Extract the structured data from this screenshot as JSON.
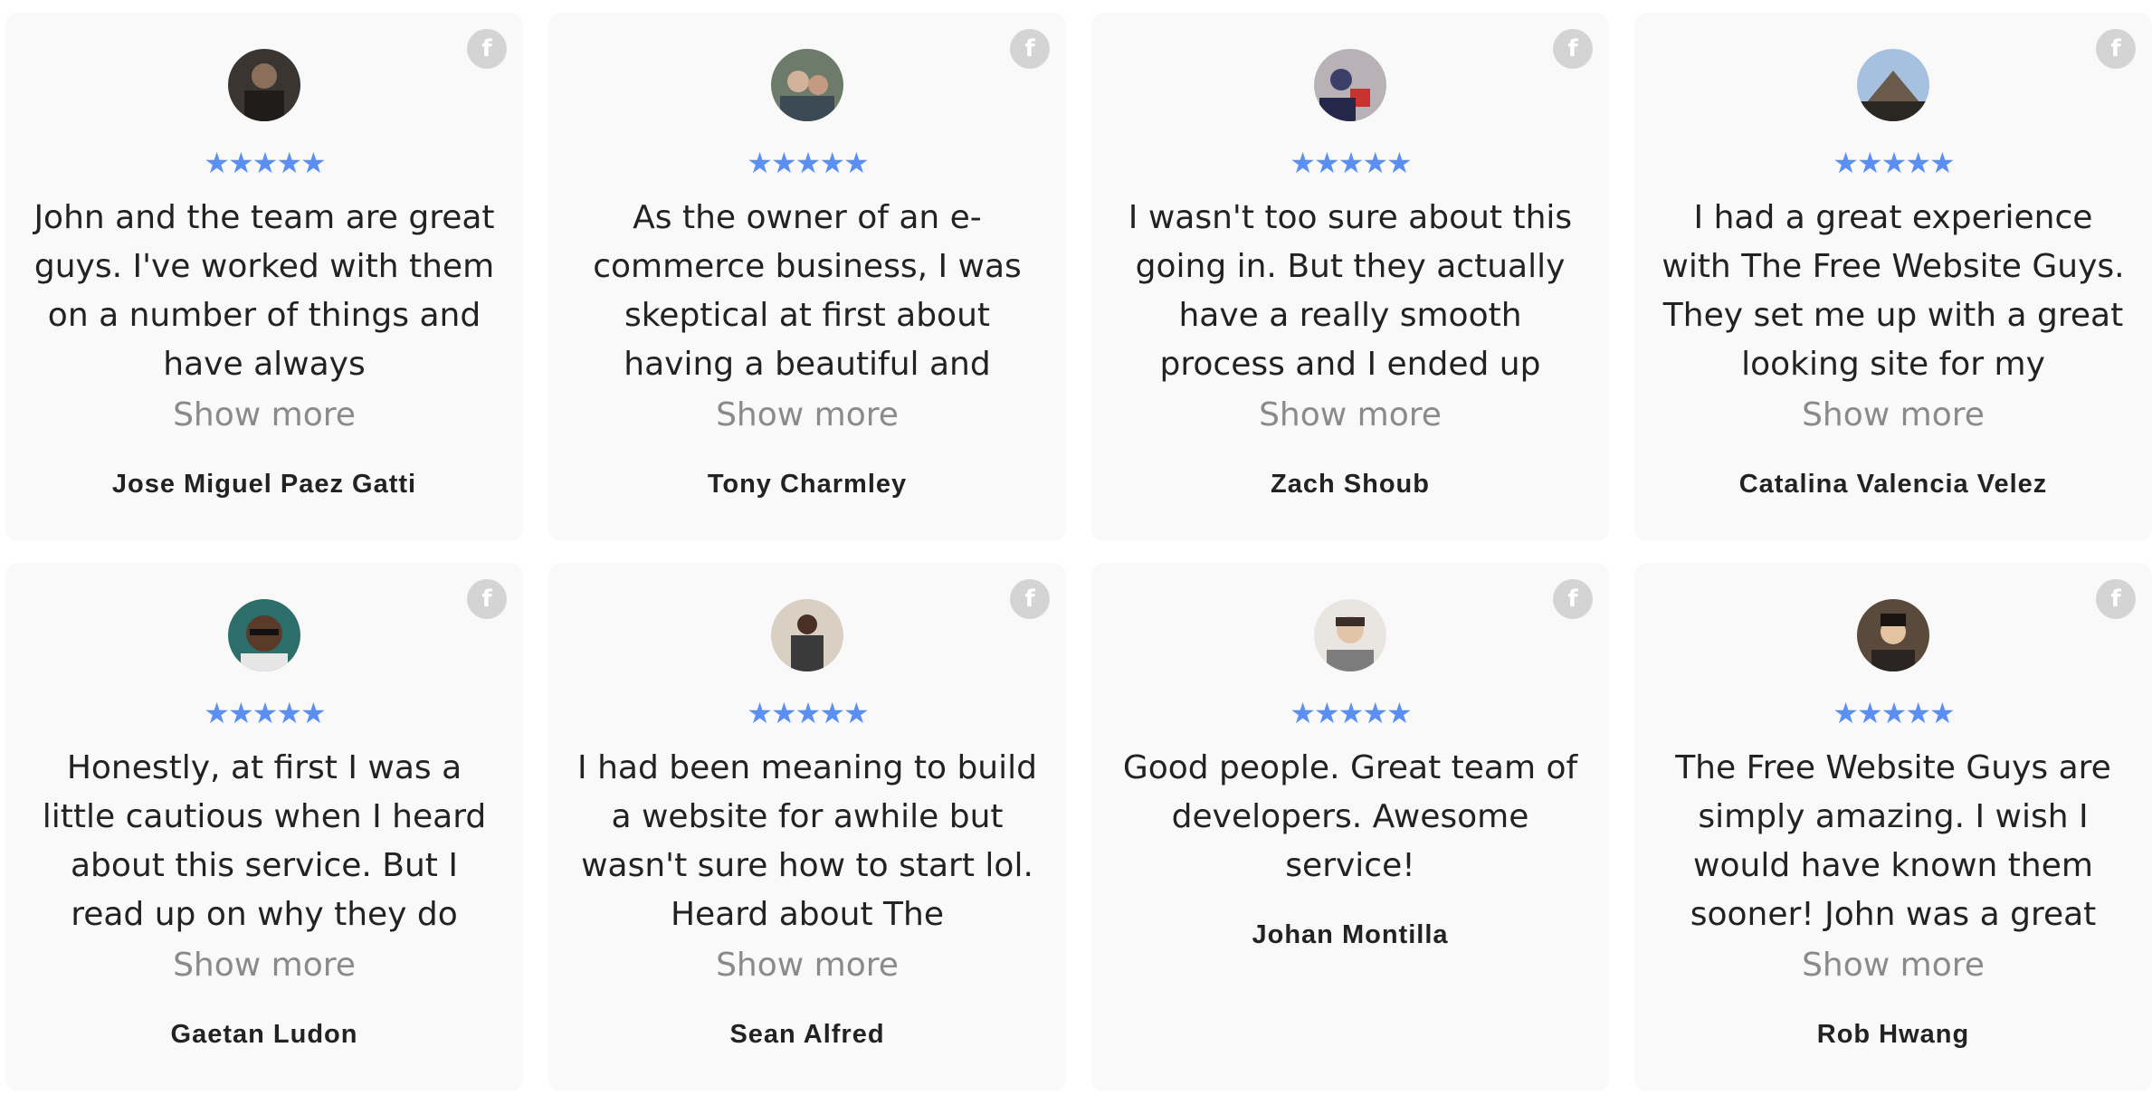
{
  "reviews": [
    {
      "name": "Jose Miguel Paez Gatti",
      "rating": 5,
      "text": "John and the team are great guys. I've worked with them on a number of things and have always",
      "show_more": "Show more",
      "truncated": true,
      "avatar_color": "#3a3530"
    },
    {
      "name": "Tony Charmley",
      "rating": 5,
      "text": "As the owner of an e-commerce business, I was skeptical at first about having a beautiful and",
      "show_more": "Show more",
      "truncated": true,
      "avatar_color": "#6c7b6a"
    },
    {
      "name": "Zach Shoub",
      "rating": 5,
      "text": "I wasn't too sure about this going in. But they actually have a really smooth process and I ended up",
      "show_more": "Show more",
      "truncated": true,
      "avatar_color": "#8a6f6d"
    },
    {
      "name": "Catalina Valencia Velez",
      "rating": 5,
      "text": "I had a great experience with The Free Website Guys. They set me up with a great looking site for my",
      "show_more": "Show more",
      "truncated": true,
      "avatar_color": "#7fa0c4"
    },
    {
      "name": "Gaetan Ludon",
      "rating": 5,
      "text": "Honestly, at first I was a little cautious when I heard about this service. But I read up on why they do",
      "show_more": "Show more",
      "truncated": true,
      "avatar_color": "#3b2a22"
    },
    {
      "name": "Sean Alfred",
      "rating": 5,
      "text": "I had been meaning to build a website for awhile but wasn't sure how to start lol. Heard about The",
      "show_more": "Show more",
      "truncated": true,
      "avatar_color": "#b9a28d"
    },
    {
      "name": "Johan Montilla",
      "rating": 5,
      "text": "Good people. Great team of developers. Awesome service!",
      "show_more": "",
      "truncated": false,
      "avatar_color": "#c9c3be"
    },
    {
      "name": "Rob Hwang",
      "rating": 5,
      "text": "The Free Website Guys are simply amazing. I wish I would have known them sooner! John was a great",
      "show_more": "Show more",
      "truncated": true,
      "avatar_color": "#2e2a26"
    }
  ],
  "icons": {
    "source": "facebook-icon",
    "star": "star-icon"
  },
  "colors": {
    "star": "#5b8ff2",
    "card": "#f9f9f9",
    "badge": "#d4d4d4"
  }
}
